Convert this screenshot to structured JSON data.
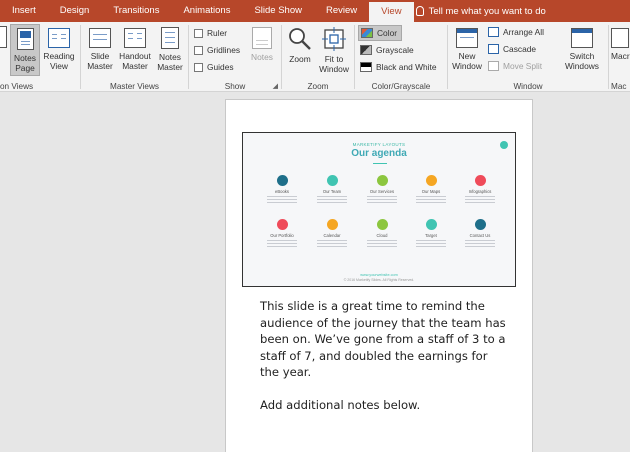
{
  "tabs": [
    {
      "label": "Insert",
      "active": false
    },
    {
      "label": "Design",
      "active": false
    },
    {
      "label": "Transitions",
      "active": false
    },
    {
      "label": "Animations",
      "active": false
    },
    {
      "label": "Slide Show",
      "active": false
    },
    {
      "label": "Review",
      "active": false
    },
    {
      "label": "View",
      "active": true
    }
  ],
  "tell_me": "Tell me what you want to do",
  "ribbon": {
    "presentation_views": {
      "label": "on Views",
      "notes_page": "Notes Page",
      "reading_view": "Reading View"
    },
    "master_views": {
      "label": "Master Views",
      "slide_master": "Slide Master",
      "handout_master": "Handout Master",
      "notes_master": "Notes Master"
    },
    "show": {
      "label": "Show",
      "ruler": "Ruler",
      "gridlines": "Gridlines",
      "guides": "Guides",
      "notes": "Notes"
    },
    "zoom": {
      "label": "Zoom",
      "zoom": "Zoom",
      "fit_to_window": "Fit to Window"
    },
    "color_grayscale": {
      "label": "Color/Grayscale",
      "color": "Color",
      "grayscale": "Grayscale",
      "black_and_white": "Black and White"
    },
    "window": {
      "label": "Window",
      "new_window": "New Window",
      "arrange_all": "Arrange All",
      "cascade": "Cascade",
      "move_split": "Move Split",
      "switch_windows": "Switch Windows"
    },
    "macros": {
      "label": "Mac",
      "btn": "Macr"
    }
  },
  "slide": {
    "small_header": "MARKETIFY LAYOUTS",
    "title": "Our agenda",
    "items": [
      {
        "name": "eBooks",
        "color": "#1e6f8a"
      },
      {
        "name": "Our Team",
        "color": "#40c4b2"
      },
      {
        "name": "Our Services",
        "color": "#8cc63f"
      },
      {
        "name": "Our Maps",
        "color": "#f5a623"
      },
      {
        "name": "Infographics",
        "color": "#ef4b5a"
      },
      {
        "name": "Our Portfolio",
        "color": "#ef4b5a"
      },
      {
        "name": "Calendar",
        "color": "#f5a623"
      },
      {
        "name": "Cloud",
        "color": "#8cc63f"
      },
      {
        "name": "Target",
        "color": "#40c4b2"
      },
      {
        "name": "Contact Us",
        "color": "#1e6f8a"
      }
    ],
    "footer_link": "www.yourwebsite.com",
    "footer_copy": "© 2016 Marketify Slides. All Rights Reserved."
  },
  "notes": {
    "paragraph1": "This slide is a great time to remind the audience of the journey that the team has been on. We’ve gone from a staff of 3 to a staff of 7, and doubled the earnings for the year.",
    "paragraph2": "Add additional notes below."
  },
  "colors": {
    "accent": "#b7472a",
    "ribbon_bg": "#f3f3f3",
    "workspace_bg": "#e6e6e6"
  }
}
